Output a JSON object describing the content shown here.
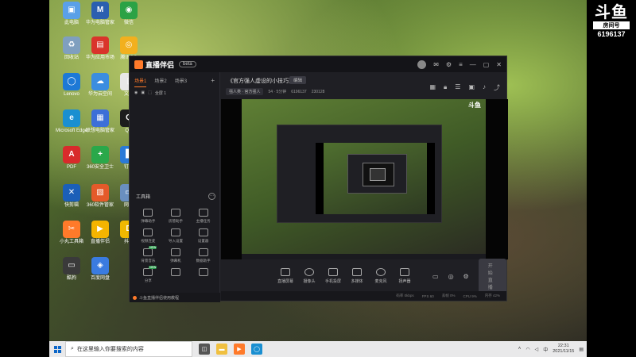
{
  "desktop": {
    "icons": [
      {
        "label": "此电脑",
        "color": "#5aa0e8",
        "glyph": "▣"
      },
      {
        "label": "华为电脑管家",
        "color": "#2a5fb0",
        "glyph": "M"
      },
      {
        "label": "微信",
        "color": "#2ba245",
        "glyph": "◉"
      },
      {
        "label": "回收站",
        "color": "#7f9fbf",
        "glyph": "♻"
      },
      {
        "label": "华为应用市场",
        "color": "#d9342b",
        "glyph": "▤"
      },
      {
        "label": "腾讯QQ",
        "color": "#f2b01e",
        "glyph": "◎"
      },
      {
        "label": "Lenovo",
        "color": "#1d79d6",
        "glyph": "◯"
      },
      {
        "label": "华为云空间",
        "color": "#3b8de0",
        "glyph": "☁"
      },
      {
        "label": "文件",
        "color": "#e8e8e8",
        "glyph": "▯"
      },
      {
        "label": "Microsoft Edge",
        "color": "#1a8fd1",
        "glyph": "e"
      },
      {
        "label": "联想电脑管家",
        "color": "#3c6fd8",
        "glyph": "▦"
      },
      {
        "label": "QQ",
        "color": "#1d1d1d",
        "glyph": "Q"
      },
      {
        "label": "PDF",
        "color": "#d82b2b",
        "glyph": "A"
      },
      {
        "label": "360安全卫士",
        "color": "#2aa84a",
        "glyph": "+"
      },
      {
        "label": "钉钉",
        "color": "#2a7ad8",
        "glyph": "▙"
      },
      {
        "label": "快剪辑",
        "color": "#1b5fb8",
        "glyph": "✕"
      },
      {
        "label": "360软件管家",
        "color": "#e55a2a",
        "glyph": "▧"
      },
      {
        "label": "网络",
        "color": "#6a8fbf",
        "glyph": "▭"
      },
      {
        "label": "小丸工具箱",
        "color": "#ff7a2a",
        "glyph": "✂"
      },
      {
        "label": "直播伴侣",
        "color": "#f5b400",
        "glyph": "▶"
      },
      {
        "label": "抖音",
        "color": "#f0b800",
        "glyph": "D"
      },
      {
        "label": "酷狗",
        "color": "#3a3a3a",
        "glyph": "▭"
      },
      {
        "label": "百度网盘",
        "color": "#3a7be0",
        "glyph": "◈"
      }
    ]
  },
  "watermark": {
    "logo": "斗鱼",
    "sub": "房间号",
    "room": "6196137"
  },
  "app": {
    "name": "直播伴侣",
    "version": "beta",
    "scene_tabs": [
      "场景1",
      "场景2",
      "场景3"
    ],
    "source_label": "全屏 1",
    "tools_header": "工具箱",
    "tools": [
      {
        "label": "弹幕助手",
        "badge": ""
      },
      {
        "label": "房管助手",
        "badge": ""
      },
      {
        "label": "主播任务",
        "badge": ""
      },
      {
        "label": "视频连麦",
        "badge": ""
      },
      {
        "label": "导入设置",
        "badge": ""
      },
      {
        "label": "设置器",
        "badge": ""
      },
      {
        "label": "背景音乐",
        "badge": "NEW"
      },
      {
        "label": "弹幕机",
        "badge": ""
      },
      {
        "label": "数据助手",
        "badge": ""
      },
      {
        "label": "分享",
        "badge": "NEW"
      },
      {
        "label": "",
        "badge": ""
      },
      {
        "label": "",
        "badge": ""
      }
    ],
    "help_text": "斗鱼直播伴侣使用教程",
    "stream_title": "《官方强人虚设的小技巧》",
    "edit_label": "编辑",
    "category": "强人类 · 官方强人",
    "info_items": [
      "54 · 5分钟",
      "6196137",
      "230128"
    ],
    "controls": [
      {
        "label": "直播屏幕",
        "round": false
      },
      {
        "label": "摄像头",
        "round": true
      },
      {
        "label": "手机投屏",
        "round": false
      },
      {
        "label": "多媒体",
        "round": false
      },
      {
        "label": "麦克风",
        "round": true
      },
      {
        "label": "扬声器",
        "round": false
      }
    ],
    "start_label": "开始直播",
    "status_items": [
      "码率 0kbps",
      "FPS 60",
      "丢帧 0%",
      "CPU 9%",
      "内存 42%"
    ]
  },
  "taskbar": {
    "search_placeholder": "在这里输入你要搜索的内容",
    "time": "22:31",
    "date": "2021/11/15",
    "lang": "中"
  }
}
